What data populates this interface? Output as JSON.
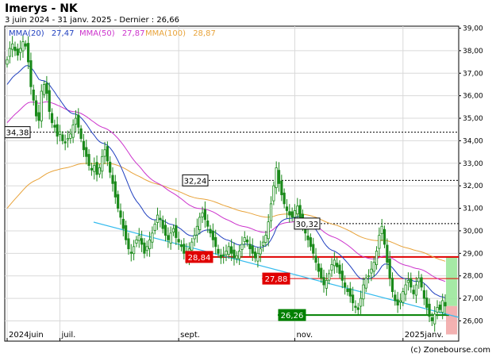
{
  "chart_data": {
    "type": "candlestick",
    "title": "Imerys - NK",
    "subtitle": "3 juin 2024 - 31 janv. 2025 - Dernier : 26,66",
    "watermark": "(c) Zonebourse.com",
    "ylim": [
      25.2,
      39.1
    ],
    "yticks": [
      "26,00",
      "27,00",
      "28,00",
      "29,00",
      "30,00",
      "31,00",
      "32,00",
      "33,00",
      "34,00",
      "35,00",
      "36,00",
      "37,00",
      "38,00",
      "39,00"
    ],
    "ytick_values": [
      26,
      27,
      28,
      29,
      30,
      31,
      32,
      33,
      34,
      35,
      36,
      37,
      38,
      39
    ],
    "xticks": [
      {
        "label": "2024juin",
        "x": 0
      },
      {
        "label": "juil.",
        "x": 20
      },
      {
        "label": "sept.",
        "x": 65
      },
      {
        "label": "nov.",
        "x": 109
      },
      {
        "label": "2025janv.",
        "x": 150
      }
    ],
    "n_bars": 169,
    "legend": [
      {
        "label": "MMA(20)",
        "value": "27,47",
        "color": "#1f3fbf"
      },
      {
        "label": "MMA(50)",
        "value": "27,87",
        "color": "#cc33cc"
      },
      {
        "label": "MMA(100)",
        "value": "28,87",
        "color": "#e8a33a"
      }
    ],
    "closes": [
      37.6,
      38.1,
      38.3,
      38.0,
      37.8,
      38.1,
      38.4,
      38.2,
      37.5,
      36.4,
      35.8,
      35.1,
      34.9,
      36.2,
      36.5,
      36.1,
      35.3,
      34.8,
      34.6,
      34.2,
      34.4,
      34.0,
      33.9,
      34.1,
      34.3,
      34.7,
      35.0,
      34.6,
      34.1,
      33.6,
      33.3,
      32.9,
      32.7,
      32.9,
      32.5,
      32.8,
      33.3,
      33.6,
      33.1,
      32.6,
      32.1,
      31.5,
      31.0,
      30.6,
      30.1,
      29.6,
      29.2,
      29.0,
      29.3,
      29.6,
      29.8,
      29.4,
      29.0,
      29.3,
      29.6,
      29.9,
      30.3,
      30.7,
      30.5,
      30.1,
      29.8,
      29.6,
      29.9,
      30.1,
      29.7,
      29.5,
      29.3,
      29.0,
      28.9,
      29.2,
      29.5,
      29.8,
      30.2,
      30.6,
      30.8,
      30.5,
      30.2,
      29.9,
      29.6,
      29.3,
      29.0,
      28.8,
      28.9,
      29.1,
      29.3,
      29.0,
      28.8,
      28.9,
      29.1,
      29.4,
      29.7,
      29.5,
      29.2,
      29.0,
      28.8,
      29.0,
      29.2,
      29.5,
      29.8,
      30.4,
      31.2,
      32.0,
      32.8,
      32.1,
      31.6,
      31.2,
      30.9,
      30.7,
      30.6,
      30.9,
      31.1,
      30.6,
      30.2,
      29.9,
      29.6,
      29.3,
      29.0,
      28.6,
      28.2,
      27.9,
      27.6,
      27.8,
      28.1,
      28.5,
      28.7,
      28.4,
      28.1,
      27.8,
      27.5,
      27.3,
      27.1,
      26.8,
      26.6,
      26.5,
      27.0,
      27.6,
      27.9,
      28.0,
      28.3,
      28.6,
      29.1,
      29.8,
      30.2,
      29.4,
      28.6,
      27.9,
      27.3,
      26.9,
      26.7,
      26.9,
      27.3,
      27.6,
      27.8,
      27.5,
      27.2,
      27.6,
      27.9,
      27.5,
      27.0,
      26.6,
      26.2,
      26.0,
      26.3,
      26.6,
      26.5,
      26.9,
      26.66
    ]
  },
  "annotations": {
    "hline_34_38": {
      "label": "34,38",
      "value": 34.38,
      "color": "#000000"
    },
    "hline_32_24": {
      "label": "32,24",
      "value": 32.24,
      "color": "#000000"
    },
    "hline_30_32": {
      "label": "30,32",
      "value": 30.32,
      "color": "#000000"
    },
    "resistance_28_84": {
      "label": "28,84",
      "value": 28.84,
      "color": "#e00000"
    },
    "resistance_27_88": {
      "label": "27,88",
      "value": 27.88,
      "color": "#e00000"
    },
    "support_26_26": {
      "label": "26,26",
      "value": 26.26,
      "color": "#008000"
    },
    "trendline_color": "#33bbee"
  }
}
